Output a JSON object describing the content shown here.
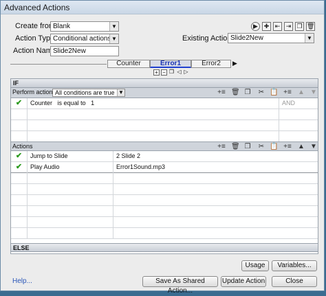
{
  "window": {
    "title": "Advanced Actions"
  },
  "form": {
    "create_from_label": "Create from:",
    "create_from_value": "Blank",
    "action_type_label": "Action Type:",
    "action_type_value": "Conditional actions",
    "action_name_label": "Action Name:",
    "action_name_value": "Slide2New",
    "existing_actions_label": "Existing Actions:",
    "existing_actions_value": "Slide2New"
  },
  "decision_tabs": [
    "Counter",
    "Error1",
    "Error2"
  ],
  "if_section": {
    "label": "IF",
    "perform_label": "Perform action if:",
    "perform_value": "All conditions are true",
    "conditions": [
      {
        "var": "Counter",
        "op": "is equal to",
        "value": "1",
        "connector": "AND"
      }
    ]
  },
  "actions_section": {
    "label": "Actions",
    "rows": [
      {
        "action": "Jump to Slide",
        "target": "2 Slide 2"
      },
      {
        "action": "Play Audio",
        "target": "Error1Sound.mp3"
      }
    ]
  },
  "else_label": "ELSE",
  "buttons": {
    "usage": "Usage",
    "variables": "Variables...",
    "help": "Help...",
    "save_shared": "Save As Shared Action...",
    "update": "Update Action",
    "close": "Close"
  },
  "colors": {
    "check": "#2c9a1e",
    "active_tab": "#1a33b5",
    "link": "#2a56b8"
  }
}
